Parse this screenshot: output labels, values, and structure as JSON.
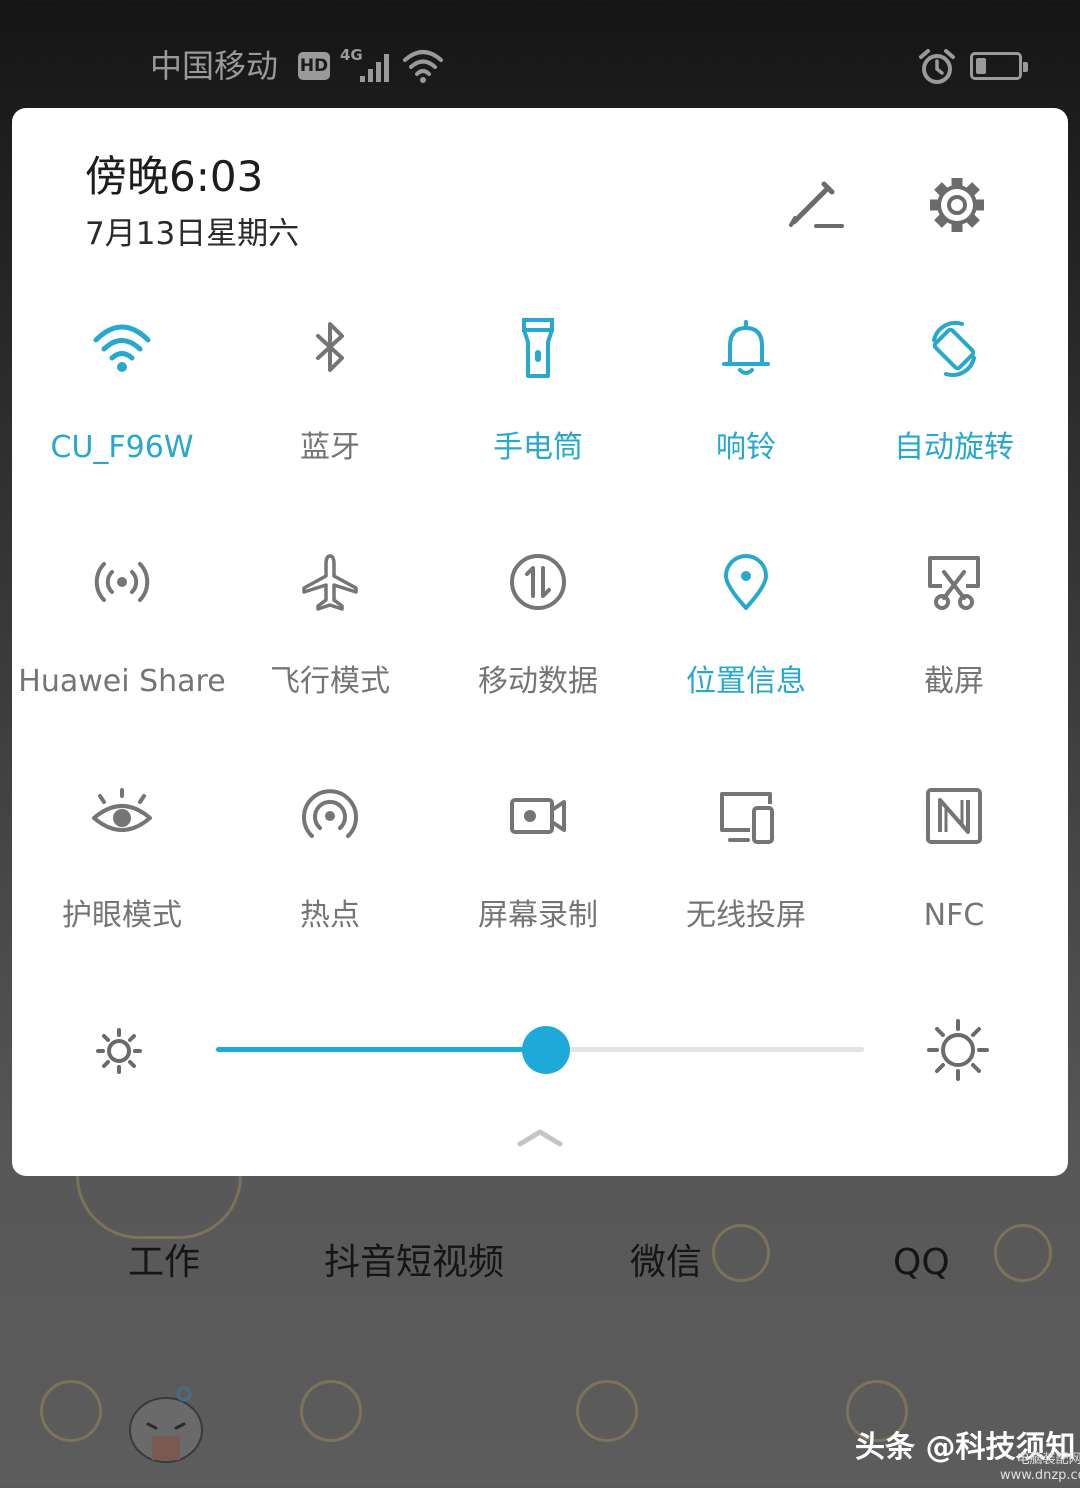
{
  "status_bar": {
    "carrier": "中国移动",
    "hd_label": "HD",
    "network_label": "4G",
    "battery_level": 0.25
  },
  "panel": {
    "time": "傍晚6:03",
    "date": "7月13日星期六",
    "tiles": [
      {
        "label": "CU_F96W",
        "icon": "wifi-icon",
        "active": true
      },
      {
        "label": "蓝牙",
        "icon": "bluetooth-icon",
        "active": false
      },
      {
        "label": "手电筒",
        "icon": "flashlight-icon",
        "active": true
      },
      {
        "label": "响铃",
        "icon": "bell-icon",
        "active": true
      },
      {
        "label": "自动旋转",
        "icon": "auto-rotate-icon",
        "active": true
      },
      {
        "label": "Huawei Share",
        "icon": "huawei-share-icon",
        "active": false
      },
      {
        "label": "飞行模式",
        "icon": "airplane-icon",
        "active": false
      },
      {
        "label": "移动数据",
        "icon": "mobile-data-icon",
        "active": false
      },
      {
        "label": "位置信息",
        "icon": "location-icon",
        "active": true
      },
      {
        "label": "截屏",
        "icon": "screenshot-icon",
        "active": false
      },
      {
        "label": "护眼模式",
        "icon": "eye-comfort-icon",
        "active": false
      },
      {
        "label": "热点",
        "icon": "hotspot-icon",
        "active": false
      },
      {
        "label": "屏幕录制",
        "icon": "screen-record-icon",
        "active": false
      },
      {
        "label": "无线投屏",
        "icon": "wireless-projection-icon",
        "active": false
      },
      {
        "label": "NFC",
        "icon": "nfc-icon",
        "active": false
      }
    ],
    "brightness": 0.51
  },
  "home_apps": [
    "工作",
    "抖音短视频",
    "微信",
    "QQ"
  ],
  "watermark": "头条 @科技须知",
  "site_mark": {
    "name": "电脑装配网",
    "url": "www.dnzp.com"
  },
  "colors": {
    "accent": "#28a8cf",
    "inactive": "#757575",
    "slider": "#1eaad8"
  }
}
